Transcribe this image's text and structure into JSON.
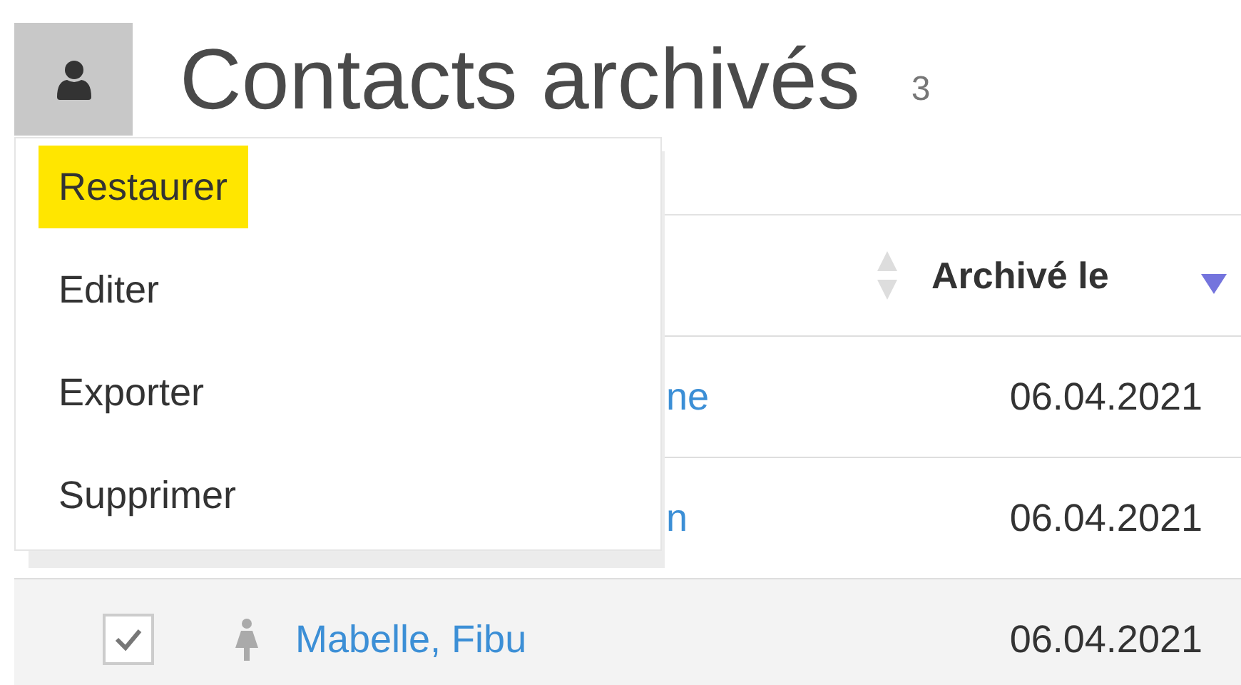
{
  "header": {
    "title": "Contacts archivés",
    "count": "3"
  },
  "menu": {
    "items": [
      {
        "label": "Restaurer",
        "selected": true
      },
      {
        "label": "Editer",
        "selected": false
      },
      {
        "label": "Exporter",
        "selected": false
      },
      {
        "label": "Supprimer",
        "selected": false
      }
    ]
  },
  "table": {
    "columns": [
      {
        "sorted": false
      },
      {
        "label": "Archivé le",
        "sorted": true
      }
    ],
    "rows": [
      {
        "name": "ne",
        "date": "06.04.2021",
        "selected": false
      },
      {
        "name": "n",
        "date": "06.04.2021",
        "selected": false
      },
      {
        "name": "Mabelle, Fibu",
        "date": "06.04.2021",
        "selected": true,
        "checked": true,
        "kind": "female"
      }
    ]
  }
}
